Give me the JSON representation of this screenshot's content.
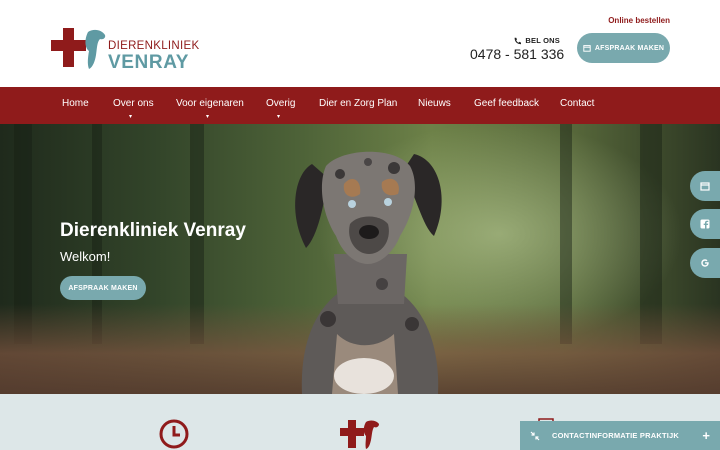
{
  "header": {
    "logo_line1": "DIERENKLINIEK",
    "logo_line2": "VENRAY",
    "online_order": "Online bestellen",
    "call_label": "BEL ONS",
    "phone": "0478 - 581 336",
    "appointment_button": "AFSPRAAK MAKEN"
  },
  "nav": {
    "items": [
      {
        "label": "Home"
      },
      {
        "label": "Over ons"
      },
      {
        "label": "Voor eigenaren"
      },
      {
        "label": "Overig"
      },
      {
        "label": "Dier en Zorg Plan"
      },
      {
        "label": "Nieuws"
      },
      {
        "label": "Geef feedback"
      },
      {
        "label": "Contact"
      }
    ]
  },
  "hero": {
    "title": "Dierenkliniek Venray",
    "subtitle": "Welkom!",
    "button": "AFSPRAAK MAKEN"
  },
  "side_tabs": [
    {
      "icon": "calendar-icon"
    },
    {
      "icon": "facebook-icon"
    },
    {
      "icon": "google-icon"
    }
  ],
  "footer_bar": {
    "contact_label": "CONTACTINFORMATIE PRAKTIJK"
  },
  "colors": {
    "brand_red": "#8f1b1b",
    "brand_teal": "#79a9ae",
    "band_bg": "#dde7e8"
  }
}
